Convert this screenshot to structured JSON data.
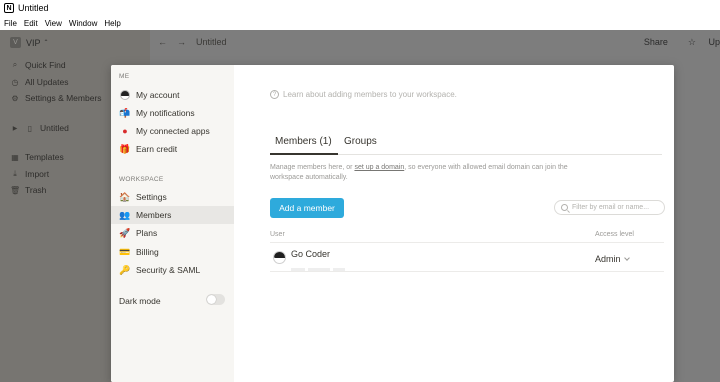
{
  "window": {
    "title": "Untitled",
    "app_icon_letter": "N",
    "menu": [
      "File",
      "Edit",
      "View",
      "Window",
      "Help"
    ]
  },
  "app": {
    "workspace_name": "VIP",
    "workspace_initial": "V",
    "sidebar": {
      "quick_find": "Quick Find",
      "all_updates": "All Updates",
      "settings_members": "Settings & Members",
      "page": "Untitled",
      "templates": "Templates",
      "import": "Import",
      "trash": "Trash"
    },
    "topbar": {
      "breadcrumb": "Untitled",
      "share": "Share",
      "updates": "Up"
    }
  },
  "settings_modal": {
    "sidebar": {
      "me_heading": "ME",
      "my_account": "My account",
      "my_notifications": "My notifications",
      "my_connected_apps": "My connected apps",
      "earn_credit": "Earn credit",
      "workspace_heading": "WORKSPACE",
      "settings": "Settings",
      "members": "Members",
      "plans": "Plans",
      "billing": "Billing",
      "security_saml": "Security & SAML",
      "dark_mode": "Dark mode"
    },
    "learn_text": "Learn about adding members to your workspace.",
    "tabs": {
      "members": "Members (1)",
      "groups": "Groups"
    },
    "description": {
      "before_link": "Manage members here, or",
      "link": "set up a domain",
      "after_link": ", so everyone with allowed email domain can join the workspace automatically."
    },
    "add_member_button": "Add a member",
    "filter_placeholder": "Filter by email or name...",
    "table": {
      "col_user": "User",
      "col_access": "Access level",
      "rows": [
        {
          "name": "Go Coder",
          "access": "Admin"
        }
      ]
    }
  }
}
